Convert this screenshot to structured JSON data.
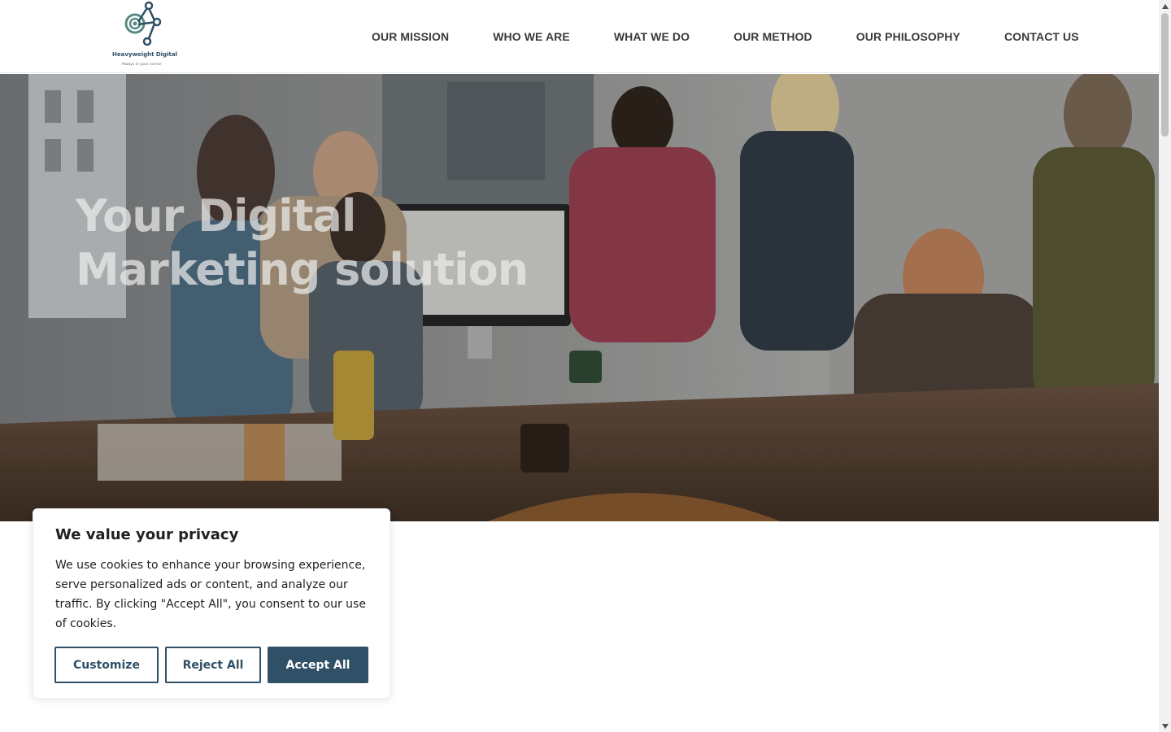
{
  "logo": {
    "name": "Heavyweight Digital",
    "tagline": "Always in your corner"
  },
  "nav": {
    "items": [
      {
        "label": "OUR MISSION"
      },
      {
        "label": "WHO WE ARE"
      },
      {
        "label": "WHAT WE DO"
      },
      {
        "label": "OUR METHOD"
      },
      {
        "label": "OUR PHILOSOPHY"
      },
      {
        "label": "CONTACT US"
      }
    ]
  },
  "hero": {
    "title_line1": "Your Digital",
    "title_line2": "Marketing solution"
  },
  "cookie": {
    "title": "We value your privacy",
    "text": "We use cookies to enhance your browsing experience, serve personalized ads or content, and analyze our traffic. By clicking \"Accept All\", you consent to our use of cookies.",
    "customize_label": "Customize",
    "reject_label": "Reject All",
    "accept_label": "Accept All"
  },
  "colors": {
    "brand": "#2f5066",
    "logo_teal": "#5a8a84",
    "nav_text": "#3a3a3a"
  },
  "icons": {
    "logo": "network-nodes-icon",
    "scroll_up": "triangle-up-icon",
    "scroll_down": "triangle-down-icon"
  }
}
